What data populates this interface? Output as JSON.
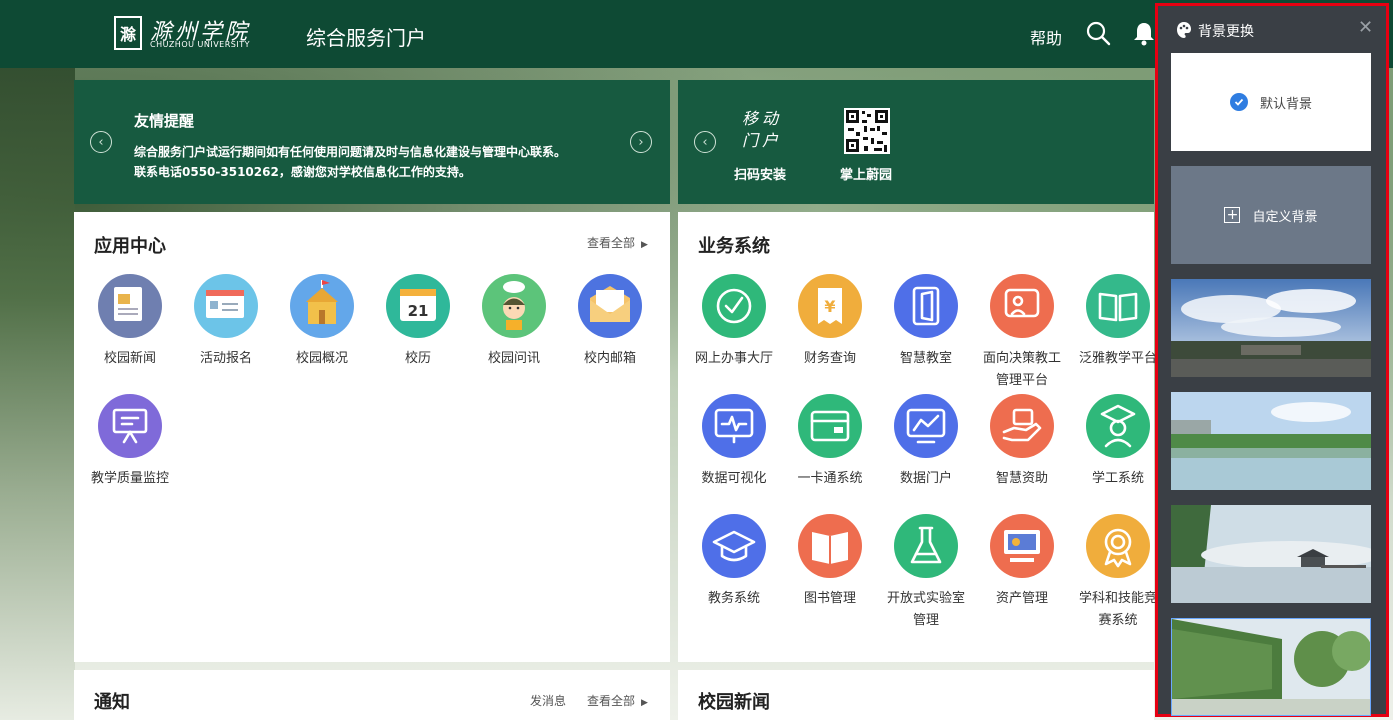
{
  "header": {
    "logo_mark": "滁",
    "logo_cn": "滁州学院",
    "logo_en": "CHUZHOU UNIVERSITY",
    "portal_title": "综合服务门户",
    "help": "帮助"
  },
  "notice": {
    "title": "友情提醒",
    "line1": "综合服务门户试运行期间如有任何使用问题请及时与信息化建设与管理中心联系。",
    "line2": "联系电话0550-3510262，感谢您对学校信息化工作的支持。"
  },
  "mobile": {
    "title": "移动门户",
    "scan_label": "扫码安装",
    "app_label": "掌上蔚园"
  },
  "app_center": {
    "title": "应用中心",
    "view_all": "查看全部",
    "items": [
      {
        "label": "校园新闻",
        "color": "#6f7fb0"
      },
      {
        "label": "活动报名",
        "color": "#6cc4e8"
      },
      {
        "label": "校园概况",
        "color": "#63a7ea"
      },
      {
        "label": "校历",
        "color": "#2fb89a"
      },
      {
        "label": "校园问讯",
        "color": "#5cc47a"
      },
      {
        "label": "校内邮箱",
        "color": "#4d73e0"
      },
      {
        "label": "教学质量监控",
        "color": "#7f6ad9"
      }
    ]
  },
  "business": {
    "title": "业务系统",
    "items": [
      {
        "label": "网上办事大厅",
        "color": "#2fb87a"
      },
      {
        "label": "财务查询",
        "color": "#f0ad3c"
      },
      {
        "label": "智慧教室",
        "color": "#4f6fe8"
      },
      {
        "label": "面向决策教工管理平台",
        "color": "#ee6d4f"
      },
      {
        "label": "泛雅教学平台",
        "color": "#34b98b"
      },
      {
        "label": "数据可视化",
        "color": "#4f6fe8"
      },
      {
        "label": "一卡通系统",
        "color": "#2fb87a"
      },
      {
        "label": "数据门户",
        "color": "#4f6fe8"
      },
      {
        "label": "智慧资助",
        "color": "#ee6d4f"
      },
      {
        "label": "学工系统",
        "color": "#2fb87a"
      },
      {
        "label": "教务系统",
        "color": "#4f6fe8"
      },
      {
        "label": "图书管理",
        "color": "#ee6d4f"
      },
      {
        "label": "开放式实验室管理",
        "color": "#2fb87a"
      },
      {
        "label": "资产管理",
        "color": "#ee6d4f"
      },
      {
        "label": "学科和技能竞赛系统",
        "color": "#f0ad3c"
      }
    ]
  },
  "notify": {
    "title": "通知",
    "send": "发消息",
    "view_all": "查看全部"
  },
  "campus_news": {
    "title": "校园新闻"
  },
  "bg_panel": {
    "title": "背景更换",
    "default_label": "默认背景",
    "custom_label": "自定义背景"
  }
}
